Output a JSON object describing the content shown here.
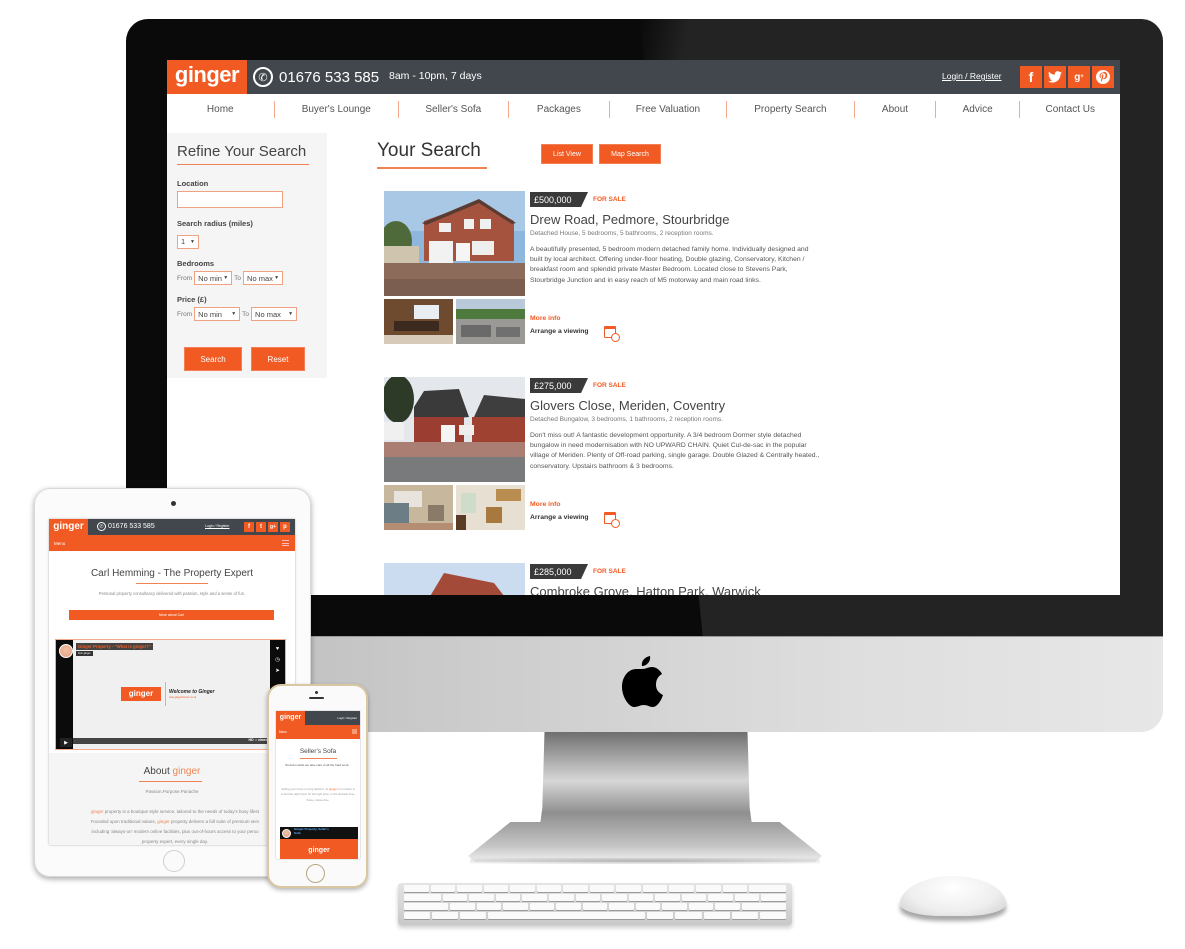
{
  "desktop": {
    "brand": "ginger",
    "phone": "01676 533 585",
    "hours": "8am - 10pm, 7 days",
    "login": "Login / Register",
    "social": [
      {
        "name": "facebook-icon",
        "glyph": "f",
        "label": "Facebook"
      },
      {
        "name": "twitter-icon",
        "glyph": "🐦",
        "label": "Twitter"
      },
      {
        "name": "google-plus-icon",
        "glyph": "g+",
        "label": "Google+"
      },
      {
        "name": "pinterest-icon",
        "glyph": "P",
        "label": "Pinterest"
      }
    ],
    "nav": [
      "Home",
      "Buyer's Lounge",
      "Seller's Sofa",
      "Packages",
      "Free Valuation",
      "Property Search",
      "About",
      "Advice",
      "Contact Us"
    ],
    "sidebar": {
      "title": "Refine Your Search",
      "location_label": "Location",
      "location_value": "",
      "radius_label": "Search radius (miles)",
      "radius_value": "1",
      "bedrooms_label": "Bedrooms",
      "bedrooms_from_label": "From",
      "bedrooms_from": "No min",
      "bedrooms_to_label": "To",
      "bedrooms_to": "No max",
      "price_label": "Price (£)",
      "price_from_label": "From",
      "price_from": "No min",
      "price_to_label": "To",
      "price_to": "No max",
      "search_button": "Search",
      "reset_button": "Reset"
    },
    "main": {
      "title": "Your Search",
      "list_view": "List View",
      "map_search": "Map Search",
      "more_info": "More info",
      "arrange_viewing": "Arrange a viewing",
      "listings": [
        {
          "price": "£500,000",
          "status": "FOR SALE",
          "title": "Drew Road, Pedmore, Stourbridge",
          "summary": "Detached House, 5 bedrooms, 5 bathrooms, 2 reception rooms.",
          "description": "A beautifully presented, 5 bedroom modern detached family home. Individually designed and built by local architect. Offering under-floor heating, Double glazing, Conservatory, Kitchen / breakfast room and splendid private Master Bedroom. Located close to Stevens Park, Stourbridge Junction and in easy reach of M5 motorway and main road links."
        },
        {
          "price": "£275,000",
          "status": "FOR SALE",
          "title": "Glovers Close, Meriden, Coventry",
          "summary": "Detached Bungalow, 3 bedrooms, 1 bathrooms, 2 reception rooms.",
          "description": "Don't miss out! A fantastic development opportunity. A 3/4 bedroom Dormer style detached bungalow in need modernisation with NO UPWARD CHAIN. Quiet Cul-de-sac in the popular village of Meriden. Plenty of Off-road parking, single garage. Double Glazed & Centrally heated., conservatory. Upstairs bathroom & 3 bedrooms."
        },
        {
          "price": "£285,000",
          "status": "FOR SALE",
          "title": "Combroke Grove, Hatton Park, Warwick",
          "summary": "",
          "description": ""
        }
      ]
    }
  },
  "tablet": {
    "brand": "ginger",
    "phone": "01676 533 585",
    "login": "Login / Register",
    "menu": "Menu",
    "heading": "Carl Hemming - The Property Expert",
    "subheading": "Personal property consultancy delivered with passion, style and a sense of fun.",
    "more_button": "More about Carl",
    "video": {
      "title": "Ginger Property - \"What is ginger?\"",
      "from": "from ginger",
      "logo": "ginger",
      "welcome": "Welcome to Ginger",
      "url": "www.gingerhomes.co.uk",
      "controls": "HD :: vimeo"
    },
    "about_prefix": "About ",
    "about_accent": "ginger",
    "tagline": "Passion.Purpose.Panache",
    "para_line1_accent": "ginger",
    "para_line1": " property is a boutique style service, tailored to the needs of today's busy lifest",
    "para_line2a": "Founded upon traditional values, ",
    "para_line2_accent": "ginger",
    "para_line2b": " property delivers a full suite of premium serv",
    "para_line3": "including 'always-on' modern online facilities, plus out-of-hours access to your perso",
    "para_line4": "property expert, every single day."
  },
  "phone": {
    "brand": "ginger",
    "login": "Login / Register",
    "menu": "Menu",
    "heading": "Seller's Sofa",
    "intro": "Sit down while we take care of all the hard work...",
    "para_a": "Selling your home is a big decision. At ",
    "para_accent": "ginger",
    "para_b": " our mission is to find the right buyer for the right price, in the shortest time-frame, stress-free.",
    "video_title": "Ginger Property, Seller's Sofa",
    "video_logo": "ginger"
  },
  "colors": {
    "brand_orange": "#f15a22",
    "topbar_dark": "#41474c",
    "accent_line": "#f08352"
  }
}
